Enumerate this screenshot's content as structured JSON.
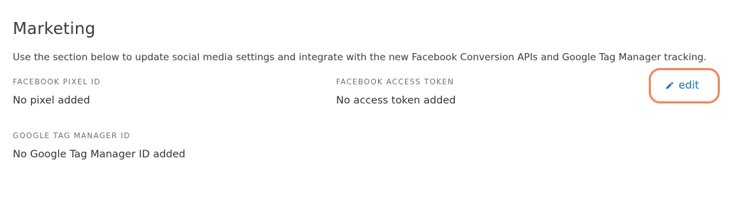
{
  "section": {
    "title": "Marketing",
    "description": "Use the section below to update social media settings and integrate with the new Facebook Conversion APIs and Google Tag Manager tracking."
  },
  "fields": [
    {
      "label": "FACEBOOK PIXEL ID",
      "value": "No pixel added"
    },
    {
      "label": "FACEBOOK ACCESS TOKEN",
      "value": "No access token added"
    },
    {
      "label": "GOOGLE TAG MANAGER ID",
      "value": "No Google Tag Manager ID added"
    }
  ],
  "edit": {
    "label": "edit",
    "icon": "pencil-icon",
    "color": "#1a6fb3",
    "highlight_color": "#f0875a"
  }
}
